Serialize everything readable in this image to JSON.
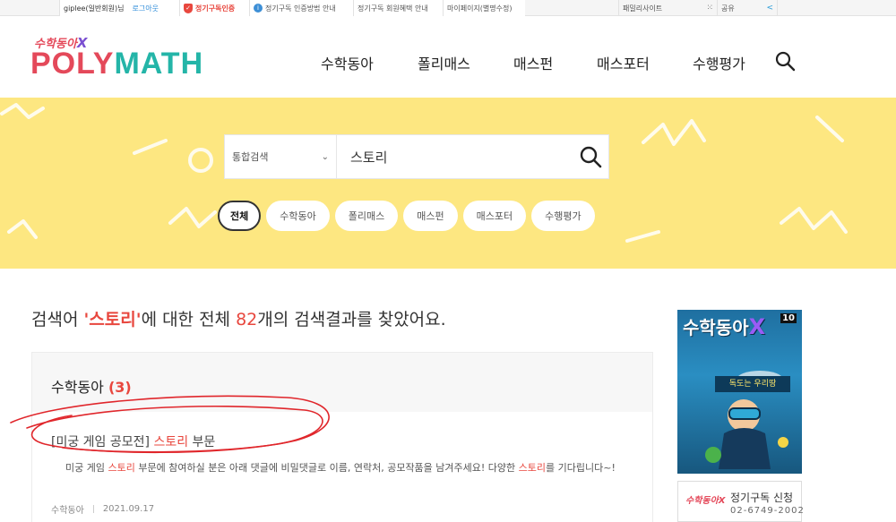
{
  "topbar": {
    "user": "giplee(일반회원)님",
    "logout": "로그아웃",
    "subscribe_verify": "정기구독인증",
    "subscribe_guide": "정기구독 인증방법 안내",
    "member_benefit": "정기구독 회원혜택 안내",
    "mypage": "마이페이지(별명수정)",
    "family_site": "패밀리사이트",
    "share": "공유"
  },
  "logo": {
    "sub": "수학동아",
    "x": "X",
    "main_a": "POLY",
    "main_b": "MATH"
  },
  "nav": [
    "수학동아",
    "폴리매스",
    "매스펀",
    "매스포터",
    "수행평가"
  ],
  "search": {
    "scope": "통합검색",
    "query": "스토리"
  },
  "chips": [
    {
      "label": "전체",
      "active": true
    },
    {
      "label": "수학동아"
    },
    {
      "label": "폴리매스"
    },
    {
      "label": "매스펀"
    },
    {
      "label": "매스포터"
    },
    {
      "label": "수행평가"
    }
  ],
  "headline": {
    "pre": "검색어 ",
    "term": "'스토리'",
    "mid": "에 대한 전체 ",
    "count": "82",
    "post": "개의 검색결과를 찾았어요."
  },
  "result_group": {
    "category": "수학동아",
    "count": "(3)",
    "item": {
      "title_pre": "[미궁 게임 공모전] ",
      "title_term": "스토리",
      "title_post": " 부문",
      "snippet_a": "미궁 게임 ",
      "snippet_term1": "스토리",
      "snippet_b": " 부문에 참여하실 분은 아래 댓글에 비밀댓글로 이름, 연락처, 공모작품을 남겨주세요! 다양한 ",
      "snippet_term2": "스토리",
      "snippet_c": "를 기다립니다~!",
      "source": "수학동아",
      "date": "2021.09.17"
    }
  },
  "sidebar": {
    "cover_title": "수학동아",
    "cover_x": "X",
    "cover_issue": "10",
    "cover_banner": "독도는 우리땅",
    "sub_logo": "수학동아X",
    "sub_label": "정기구독 신청",
    "sub_phone": "02-6749-2002"
  },
  "colors": {
    "accent_red": "#e8473e",
    "band_yellow": "#fde781",
    "logo_teal": "#24b5a8"
  }
}
